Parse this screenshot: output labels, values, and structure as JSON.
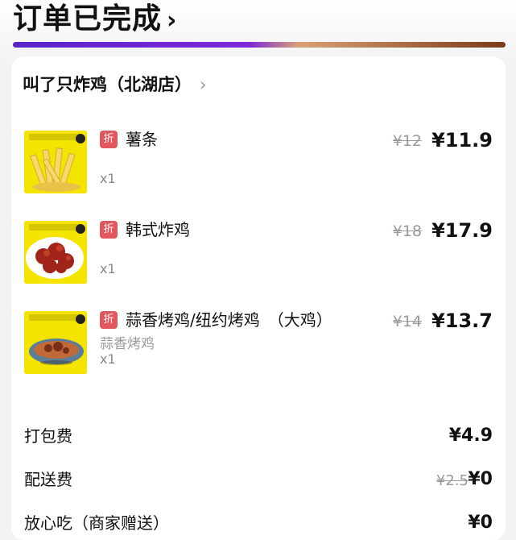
{
  "header": {
    "title": "订单已完成",
    "chevron": "›"
  },
  "store": {
    "name": "叫了只炸鸡（北湖店）",
    "chevron": "›"
  },
  "items": [
    {
      "badge": "折",
      "name": "薯条",
      "sub": "",
      "qty": "x1",
      "orig": "¥12",
      "price": "¥11.9",
      "thumb_icon": "fries-photo"
    },
    {
      "badge": "折",
      "name": "韩式炸鸡",
      "sub": "",
      "qty": "x1",
      "orig": "¥18",
      "price": "¥17.9",
      "thumb_icon": "korean-fried-chicken-photo"
    },
    {
      "badge": "折",
      "name": "蒜香烤鸡/纽约烤鸡　（大鸡）",
      "sub": "蒜香烤鸡",
      "qty": "x1",
      "orig": "¥14",
      "price": "¥13.7",
      "thumb_icon": "roast-chicken-photo"
    }
  ],
  "fees": [
    {
      "label": "打包费",
      "strike": "",
      "value": "¥4.9"
    },
    {
      "label": "配送费",
      "strike": "¥2.5",
      "value": "¥0"
    },
    {
      "label": "放心吃（商家赠送）",
      "strike": "",
      "value": "¥0"
    }
  ],
  "colors": {
    "accent_badge": "#e2565f",
    "thumb_bg": "#f4e400",
    "bar_purple": "#5a24c8",
    "bar_brown": "#7a3b18"
  }
}
